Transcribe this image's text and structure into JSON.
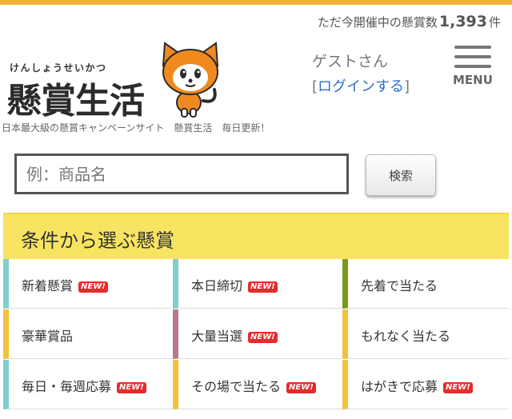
{
  "header": {
    "count_prefix": "ただ今開催中の懸賞数",
    "count_value": "1,393",
    "count_suffix": "件",
    "logo_ruby": "けんしょうせいかつ",
    "logo_text": "懸賞生活",
    "guest_text": "ゲストさん",
    "login_open": "[",
    "login_label": "ログインする",
    "login_close": "]",
    "menu_label": "MENU",
    "tagline": "日本最大級の懸賞キャンペーンサイト　懸賞生活　毎日更新！"
  },
  "search": {
    "placeholder": "例：商品名",
    "button_label": "検索"
  },
  "conditions": {
    "title": "条件から選ぶ懸賞",
    "badge_text": "NEW!",
    "items": [
      {
        "label": "新着懸賞",
        "new": true,
        "color": "#7fcfcf"
      },
      {
        "label": "本日締切",
        "new": true,
        "color": "#7fcfcf"
      },
      {
        "label": "先着で当たる",
        "new": false,
        "color": "#7a9a1a"
      },
      {
        "label": "豪華賞品",
        "new": false,
        "color": "#f3c13b"
      },
      {
        "label": "大量当選",
        "new": true,
        "color": "#b67a8a"
      },
      {
        "label": "もれなく当たる",
        "new": false,
        "color": "#f3c13b"
      },
      {
        "label": "毎日・毎週応募",
        "new": true,
        "color": "#7fcfcf"
      },
      {
        "label": "その場で当たる",
        "new": true,
        "color": "#f3c13b"
      },
      {
        "label": "はがきで応募",
        "new": true,
        "color": "#f3c13b"
      }
    ]
  }
}
